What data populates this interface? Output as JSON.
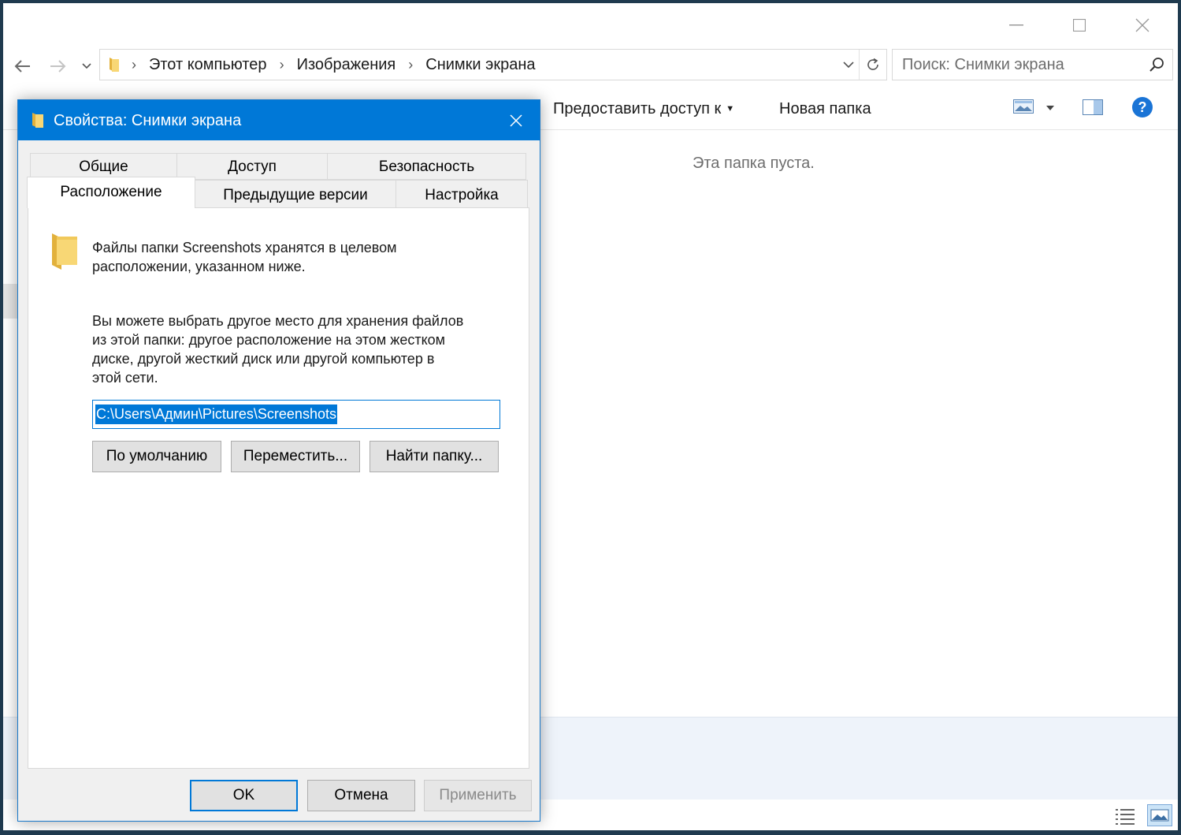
{
  "explorer": {
    "window_controls": {
      "minimize": "—",
      "maximize": "☐",
      "close": "✕"
    },
    "nav": {
      "back": "←",
      "forward": "→",
      "recent": "⌄"
    },
    "breadcrumbs": [
      "Этот компьютер",
      "Изображения",
      "Снимки экрана"
    ],
    "search": {
      "placeholder": "Поиск: Снимки экрана"
    },
    "toolbar": {
      "share": "Предоставить доступ к",
      "new_folder": "Новая папка"
    },
    "empty_message": "Эта папка пуста."
  },
  "dialog": {
    "title": "Свойства: Снимки экрана",
    "tabs_row1": [
      "Общие",
      "Доступ",
      "Безопасность"
    ],
    "tabs_row2": [
      "Расположение",
      "Предыдущие версии",
      "Настройка"
    ],
    "active_tab": "Расположение",
    "description1_line1": "Файлы папки Screenshots хранятся в целевом",
    "description1_line2": "расположении, указанном ниже.",
    "description2_line1": "Вы можете выбрать другое место для хранения файлов",
    "description2_line2": "из этой папки: другое расположение на этом жестком",
    "description2_line3": "диске, другой жесткий диск или другой компьютер в",
    "description2_line4": "этой сети.",
    "path_value": "C:\\Users\\Админ\\Pictures\\Screenshots",
    "buttons": {
      "default": "По умолчанию",
      "move": "Переместить...",
      "find": "Найти папку...",
      "ok": "OK",
      "cancel": "Отмена",
      "apply": "Применить"
    }
  },
  "colors": {
    "accent": "#0078d7",
    "folder_yellow": "#f8d775",
    "folder_dark": "#e2b13c",
    "help_blue": "#1a74d6"
  }
}
